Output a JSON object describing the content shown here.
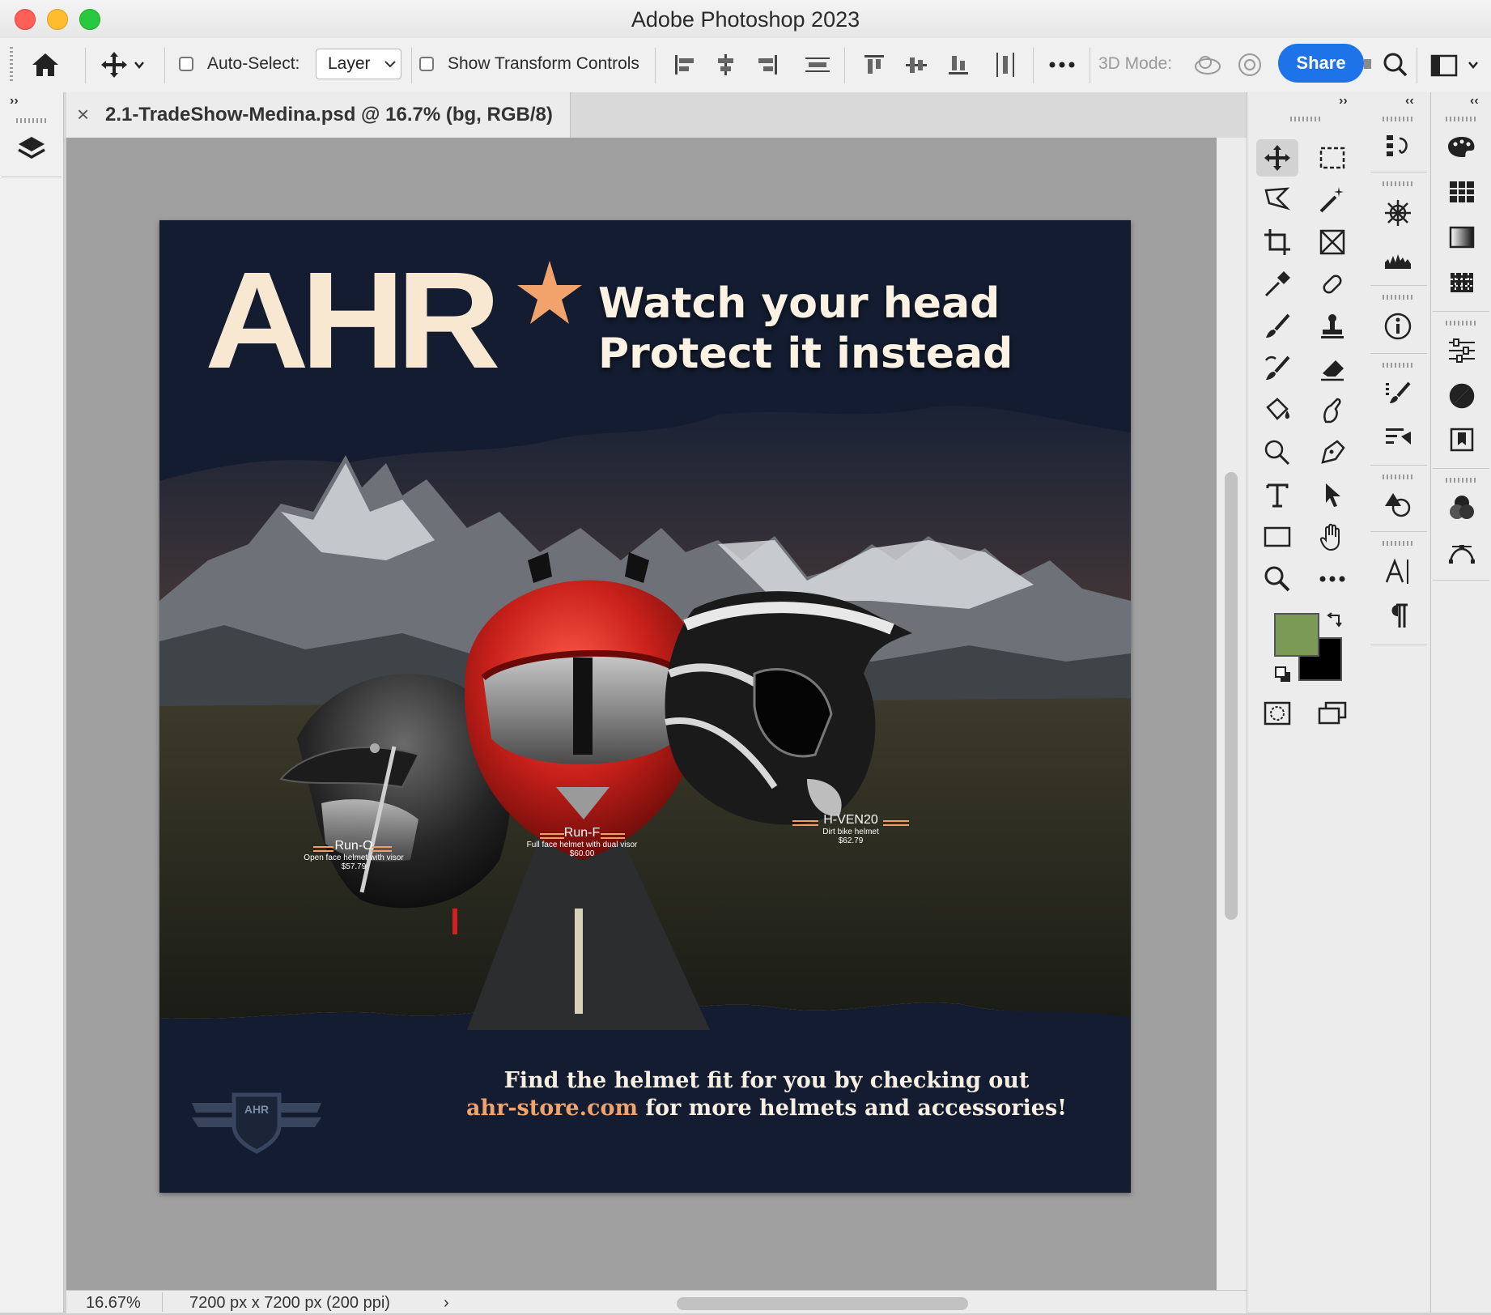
{
  "window": {
    "title": "Adobe Photoshop 2023"
  },
  "options_bar": {
    "auto_select_label": "Auto-Select:",
    "auto_select_value": "Layer",
    "show_transform_label": "Show Transform Controls",
    "mode_3d_label": "3D Mode:",
    "share_label": "Share"
  },
  "document": {
    "tab_title": "2.1-TradeShow-Medina.psd @ 16.7% (bg, RGB/8)"
  },
  "status_bar": {
    "zoom": "16.67%",
    "doc_info": "7200 px x 7200 px (200 ppi)"
  },
  "colors": {
    "foreground": "#7a9a55",
    "background": "#000000",
    "accent": "#1f73e8"
  },
  "artwork": {
    "logo_text": "AHR",
    "headline_line1": "Watch your head",
    "headline_line2": "Protect it instead",
    "products": [
      {
        "name": "Run-O",
        "desc": "Open face helmet with visor",
        "price": "$57.79"
      },
      {
        "name": "Run-F",
        "desc": "Full face helmet with dual visor",
        "price": "$60.00"
      },
      {
        "name": "H-VEN20",
        "desc": "Dirt bike helmet",
        "price": "$62.79"
      }
    ],
    "footer_line1": "Find the helmet fit for you by checking out",
    "footer_link": "ahr-store.com",
    "footer_line2_rest": " for more helmets and accessories!",
    "badge_text": "AHR"
  },
  "tools": {
    "left": [
      "move-tool",
      "lasso-tool",
      "crop-tool",
      "eyedropper-tool",
      "brush-tool",
      "history-brush-tool",
      "paint-bucket-tool",
      "smudge-tool",
      "type-tool",
      "rectangle-tool",
      "zoom-tool"
    ],
    "right": [
      "marquee-tool",
      "magic-wand-tool",
      "frame-tool",
      "healing-tool",
      "clone-stamp-tool",
      "eraser-tool",
      "blur-tool",
      "pen-tool",
      "path-selection-tool",
      "hand-tool",
      "more-tools"
    ]
  }
}
